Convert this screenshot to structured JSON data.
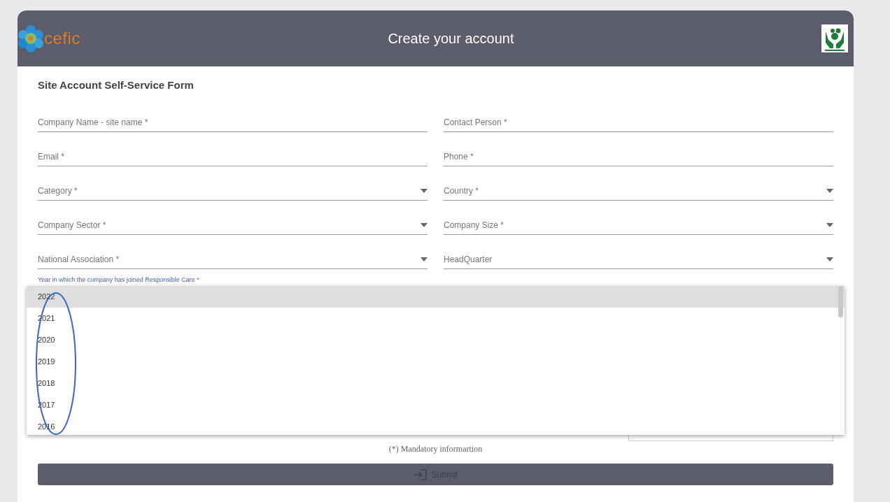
{
  "header": {
    "logo_text": "cefic",
    "title": "Create your account"
  },
  "form": {
    "title": "Site Account Self-Service Form",
    "fields": [
      {
        "label": "Company Name - site name *",
        "kind": "text"
      },
      {
        "label": "Contact Person *",
        "kind": "text"
      },
      {
        "label": "Email *",
        "kind": "text"
      },
      {
        "label": "Phone *",
        "kind": "text"
      },
      {
        "label": "Category *",
        "kind": "select"
      },
      {
        "label": "Country *",
        "kind": "select"
      },
      {
        "label": "Company Sector *",
        "kind": "select"
      },
      {
        "label": "Company Size *",
        "kind": "select"
      },
      {
        "label": "National Association *",
        "kind": "select"
      },
      {
        "label": "HeadQuarter",
        "kind": "select"
      }
    ],
    "year_field": {
      "label": "Year in which the company has joined Responsible Care",
      "required_mark": "*",
      "options": [
        {
          "label": "2022",
          "selected": true
        },
        {
          "label": "2021",
          "selected": false
        },
        {
          "label": "2020",
          "selected": false
        },
        {
          "label": "2019",
          "selected": false
        },
        {
          "label": "2018",
          "selected": false
        },
        {
          "label": "2017",
          "selected": false
        },
        {
          "label": "2016",
          "selected": false
        }
      ]
    },
    "note": "(*) Mandatory informartion",
    "submit": {
      "label": "Submit",
      "disabled": true
    }
  }
}
